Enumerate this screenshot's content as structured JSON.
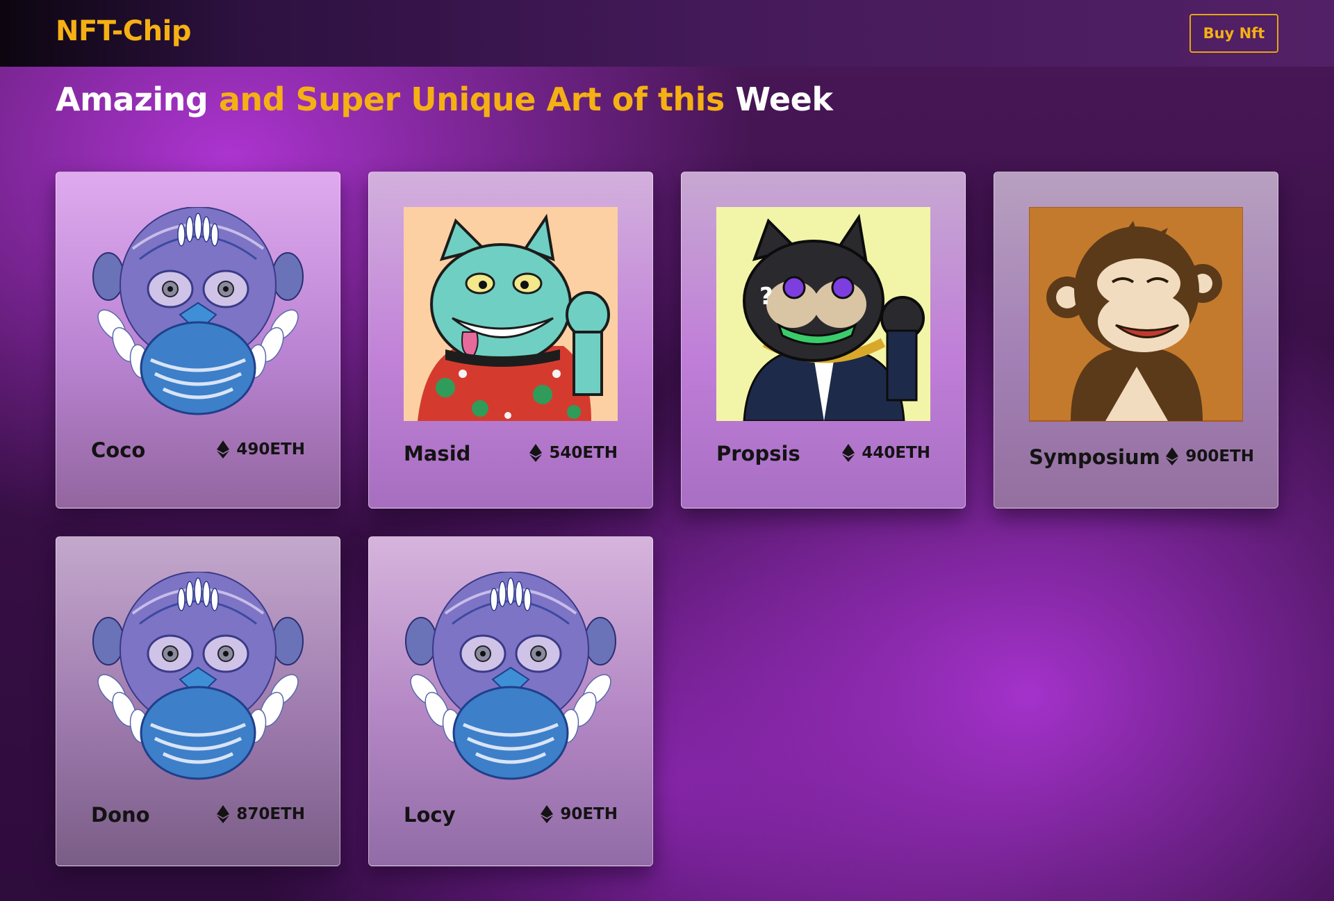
{
  "header": {
    "brand": "NFT-Chip",
    "buy_button": "Buy Nft"
  },
  "headline": {
    "part1": "Amazing ",
    "part2": "and Super Unique Art of this ",
    "part3": "Week"
  },
  "colors": {
    "accent": "#f5b014",
    "background": "#3a1048",
    "text_dark": "#131313"
  },
  "cards": [
    {
      "name": "Coco",
      "price": "490ETH",
      "art": "mandala-monkey-icon",
      "bg": "none"
    },
    {
      "name": "Masid",
      "price": "540ETH",
      "art": "zombie-cat-icon",
      "bg": "#fcd0a2"
    },
    {
      "name": "Propsis",
      "price": "440ETH",
      "art": "black-cat-icon",
      "bg": "#f2f5a8"
    },
    {
      "name": "Symposium",
      "price": "900ETH",
      "art": "cartoon-monkey-icon",
      "bg": "#c47a2c"
    },
    {
      "name": "Dono",
      "price": "870ETH",
      "art": "mandala-monkey-icon",
      "bg": "none"
    },
    {
      "name": "Locy",
      "price": "90ETH",
      "art": "mandala-monkey-icon",
      "bg": "none"
    }
  ]
}
